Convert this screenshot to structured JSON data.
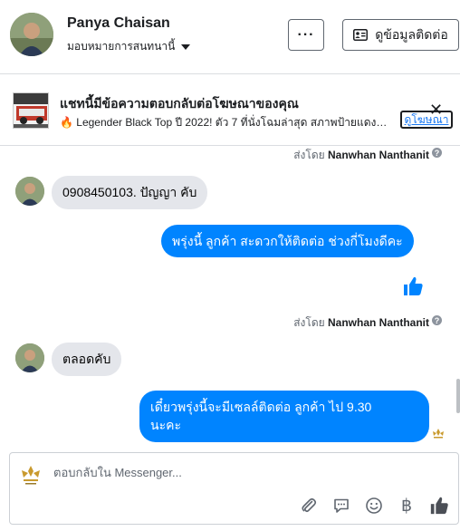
{
  "header": {
    "name": "Panya Chaisan",
    "assign_label": "มอบหมายการสนทนานี้",
    "more_label": "···",
    "contact_label": "ดูข้อมูลติดต่อ"
  },
  "ad": {
    "title": "แชทนี้มีข้อความตอบกลับต่อโฆษณาของคุณ",
    "text": "🔥 Legender Black Top ปี 2022! ตัว 7 ที่นั่งโฉมล่าสุด สภาพป้ายแดง! ...",
    "link_label": "ดูโฆษณา",
    "close": "✕"
  },
  "messages": [
    {
      "sent_by_prefix": "ส่งโดย",
      "sent_by_name": "Nanwhan Nanthanit"
    },
    {
      "text": "0908450103. ปัญญา คับ"
    },
    {
      "text": "พรุ่งนี้ ลูกค้า สะดวกให้ติดต่อ ช่วงกี่โมงดีคะ"
    },
    {
      "sent_by_prefix": "ส่งโดย",
      "sent_by_name": "Nanwhan Nanthanit"
    },
    {
      "text": "ตลอดคับ"
    },
    {
      "text_line1": "เดี๋ยวพรุ่งนี้จะมีเซลล์ติดต่อ ลูกค้า ไป  9.30",
      "text_line2": "นะคะ"
    }
  ],
  "composer": {
    "placeholder": "ตอบกลับใน Messenger...",
    "currency_symbol": "฿"
  },
  "colors": {
    "accent": "#0084ff",
    "incoming_bubble": "#e4e6eb",
    "link": "#1877f2"
  },
  "icons": [
    "chevron-down-icon",
    "contact-card-icon",
    "close-icon",
    "info-icon",
    "thumbs-up-icon",
    "paperclip-icon",
    "chat-bubble-icon",
    "emoji-icon",
    "baht-icon"
  ]
}
